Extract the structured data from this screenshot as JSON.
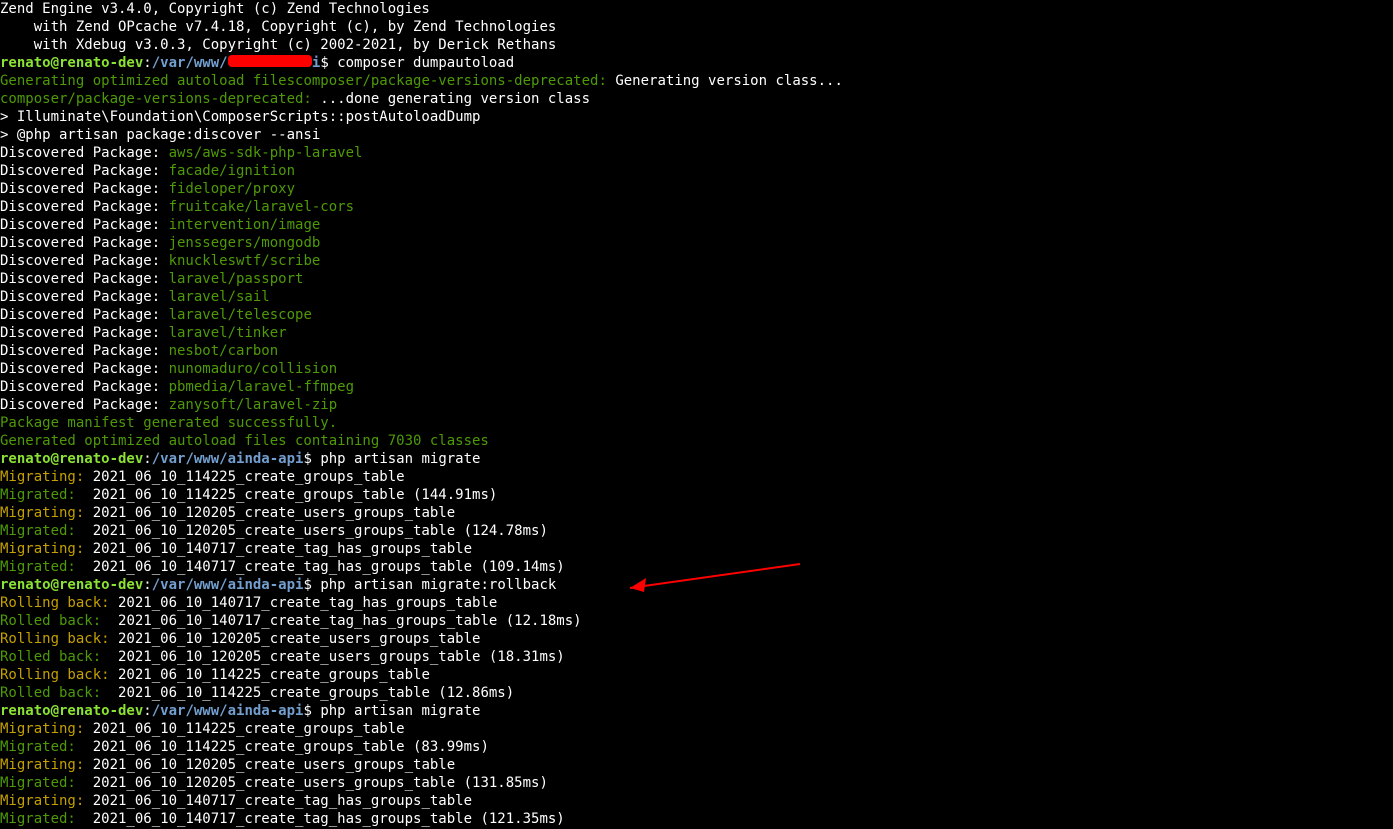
{
  "engine": {
    "l1": "Zend Engine v3.4.0, Copyright (c) Zend Technologies",
    "l2": "    with Zend OPcache v7.4.18, Copyright (c), by Zend Technologies",
    "l3": "    with Xdebug v3.0.3, Copyright (c) 2002-2021, by Derick Rethans"
  },
  "prompt": {
    "userhost": "renato@renato-dev",
    "colon": ":",
    "path1": "/var/www/",
    "redacted_pad": "          ",
    "path_suffix": "i",
    "dollar": "$ ",
    "path2": "/var/www/ainda-api"
  },
  "cmd": {
    "dumpautoload": "composer dumpautoload",
    "migrate": "php artisan migrate",
    "rollback": "php artisan migrate:rollback"
  },
  "autoload": {
    "gen1a": "Generating optimized autoload files",
    "gen1b": "composer/package-versions-deprecated:",
    "gen1c": " Generating version class...",
    "gen2a": "composer/package-versions-deprecated:",
    "gen2b": " ...done generating version class",
    "post": "> Illuminate\\Foundation\\ComposerScripts::postAutoloadDump",
    "discover": "> @php artisan package:discover --ansi",
    "success": "Package manifest generated successfully.",
    "generated": "Generated optimized autoload files containing 7030 classes"
  },
  "dp": "Discovered Package: ",
  "packages": [
    "aws/aws-sdk-php-laravel",
    "facade/ignition",
    "fideloper/proxy",
    "fruitcake/laravel-cors",
    "intervention/image",
    "jenssegers/mongodb",
    "knuckleswtf/scribe",
    "laravel/passport",
    "laravel/sail",
    "laravel/telescope",
    "laravel/tinker",
    "nesbot/carbon",
    "nunomaduro/collision",
    "pbmedia/laravel-ffmpeg",
    "zanysoft/laravel-zip"
  ],
  "mlabels": {
    "migrating": "Migrating:",
    "migrated": "Migrated:",
    "rollingback": "Rolling back:",
    "rolledback": "Rolled back:"
  },
  "m1": [
    {
      "s": "migrating",
      "t": " 2021_06_10_114225_create_groups_table"
    },
    {
      "s": "migrated",
      "t": "  2021_06_10_114225_create_groups_table (144.91ms)"
    },
    {
      "s": "migrating",
      "t": " 2021_06_10_120205_create_users_groups_table"
    },
    {
      "s": "migrated",
      "t": "  2021_06_10_120205_create_users_groups_table (124.78ms)"
    },
    {
      "s": "migrating",
      "t": " 2021_06_10_140717_create_tag_has_groups_table"
    },
    {
      "s": "migrated",
      "t": "  2021_06_10_140717_create_tag_has_groups_table (109.14ms)"
    }
  ],
  "rb": [
    {
      "s": "rollingback",
      "t": " 2021_06_10_140717_create_tag_has_groups_table"
    },
    {
      "s": "rolledback",
      "t": "  2021_06_10_140717_create_tag_has_groups_table (12.18ms)"
    },
    {
      "s": "rollingback",
      "t": " 2021_06_10_120205_create_users_groups_table"
    },
    {
      "s": "rolledback",
      "t": "  2021_06_10_120205_create_users_groups_table (18.31ms)"
    },
    {
      "s": "rollingback",
      "t": " 2021_06_10_114225_create_groups_table"
    },
    {
      "s": "rolledback",
      "t": "  2021_06_10_114225_create_groups_table (12.86ms)"
    }
  ],
  "m2": [
    {
      "s": "migrating",
      "t": " 2021_06_10_114225_create_groups_table"
    },
    {
      "s": "migrated",
      "t": "  2021_06_10_114225_create_groups_table (83.99ms)"
    },
    {
      "s": "migrating",
      "t": " 2021_06_10_120205_create_users_groups_table"
    },
    {
      "s": "migrated",
      "t": "  2021_06_10_120205_create_users_groups_table (131.85ms)"
    },
    {
      "s": "migrating",
      "t": " 2021_06_10_140717_create_tag_has_groups_table"
    },
    {
      "s": "migrated",
      "t": "  2021_06_10_140717_create_tag_has_groups_table (121.35ms)"
    }
  ]
}
